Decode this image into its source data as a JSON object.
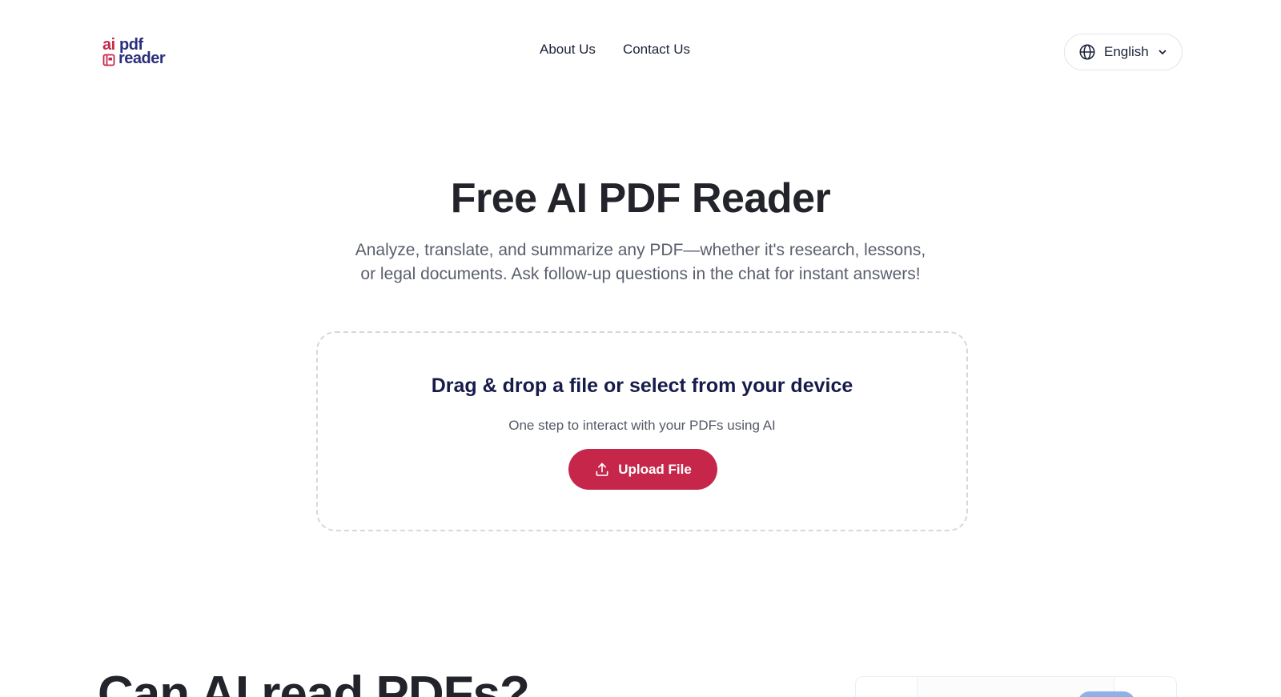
{
  "header": {
    "logo": {
      "ai": "ai",
      "pdf": "pdf",
      "reader": "reader",
      "alt": "aipdfreader"
    },
    "nav": [
      {
        "label": "About Us"
      },
      {
        "label": "Contact Us"
      }
    ],
    "language": {
      "label": "English"
    }
  },
  "hero": {
    "title": "Free AI PDF Reader",
    "subtitle": "Analyze, translate, and summarize any PDF—whether it's research, lessons, or legal documents. Ask follow-up questions in the chat for instant answers!"
  },
  "dropzone": {
    "title": "Drag & drop a file or select from your device",
    "subtitle": "One step to interact with your PDFs using AI",
    "button_label": "Upload File"
  },
  "section2": {
    "title": "Can AI read PDFs?"
  },
  "colors": {
    "brand_red": "#c7264b",
    "brand_navy": "#2a2f7a",
    "text_dark": "#23242b",
    "text_muted": "#5a5f6d",
    "dropzone_border": "#d5d8de"
  },
  "icons": {
    "globe": "globe-icon",
    "chevron": "chevron-down-icon",
    "upload": "upload-icon",
    "logo_book": "book-icon"
  }
}
